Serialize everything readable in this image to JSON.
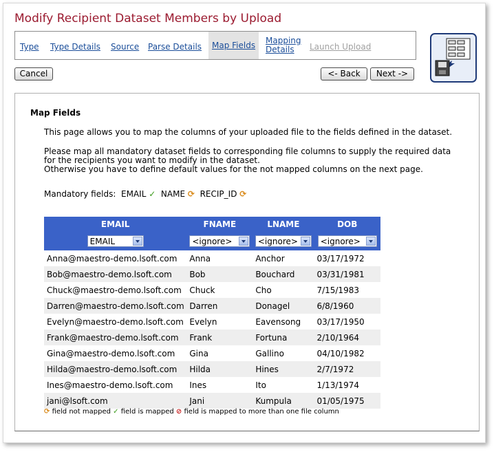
{
  "page": {
    "title": "Modify Recipient Dataset Members by Upload"
  },
  "wizard": {
    "steps": [
      {
        "label": "Type",
        "state": "link"
      },
      {
        "label": "Type Details",
        "state": "link"
      },
      {
        "label": "Source",
        "state": "link"
      },
      {
        "label": "Parse Details",
        "state": "link"
      },
      {
        "label": "Map Fields",
        "state": "active"
      },
      {
        "label": "Mapping Details",
        "state": "link"
      },
      {
        "label": "Launch Upload",
        "state": "disabled"
      }
    ],
    "mapping_line1": "Mapping",
    "mapping_line2": "Details",
    "icon": "dataset-upload-icon"
  },
  "buttons": {
    "cancel": "Cancel",
    "back": "<- Back",
    "next": "Next ->"
  },
  "content": {
    "heading": "Map Fields",
    "intro": "This page allows you to map the columns of your uploaded file to the fields defined in the dataset.",
    "instr_line1": "Please map all mandatory dataset fields to corresponding file columns to supply the required data",
    "instr_line2": "for the recipients you want to modify in the dataset.",
    "instr_line3": "Otherwise you have to define default values for the not mapped columns on the next page.",
    "mandatory_label": "Mandatory fields:",
    "mandatory": [
      {
        "name": "EMAIL",
        "status": "mapped"
      },
      {
        "name": "NAME",
        "status": "not-mapped"
      },
      {
        "name": "RECIP_ID",
        "status": "not-mapped"
      }
    ]
  },
  "table": {
    "headers": [
      "EMAIL",
      "FNAME",
      "LNAME",
      "DOB"
    ],
    "selects": [
      "EMAIL",
      "<ignore>",
      "<ignore>",
      "<ignore>"
    ],
    "rows": [
      [
        "Anna@maestro-demo.lsoft.com",
        "Anna",
        "Anchor",
        "03/17/1972"
      ],
      [
        "Bob@maestro-demo.lsoft.com",
        "Bob",
        "Bouchard",
        "03/31/1981"
      ],
      [
        "Chuck@maestro-demo.lsoft.com",
        "Chuck",
        "Cho",
        "7/15/1983"
      ],
      [
        "Darren@maestro-demo.lsoft.com",
        "Darren",
        "Donagel",
        "6/8/1960"
      ],
      [
        "Evelyn@maestro-demo.lsoft.com",
        "Evelyn",
        "Eavensong",
        "03/17/1950"
      ],
      [
        "Frank@maestro-demo.lsoft.com",
        "Frank",
        "Fortuna",
        "2/10/1964"
      ],
      [
        "Gina@maestro-demo.lsoft.com",
        "Gina",
        "Gallino",
        "04/10/1982"
      ],
      [
        "Hilda@maestro-demo.lsoft.com",
        "Hilda",
        "Hines",
        "2/7/1972"
      ],
      [
        "Ines@maestro-demo.lsoft.com",
        "Ines",
        "Ito",
        "1/13/1974"
      ],
      [
        "jani@lsoft.com",
        "Jani",
        "Kumpula",
        "01/05/1975"
      ]
    ]
  },
  "legend": {
    "not_mapped": "field not mapped",
    "mapped": "field is mapped",
    "multi": "field is mapped to more than one file column"
  },
  "colors": {
    "title": "#9b1b30",
    "link": "#1a4d99",
    "table_header": "#3a62c8"
  }
}
